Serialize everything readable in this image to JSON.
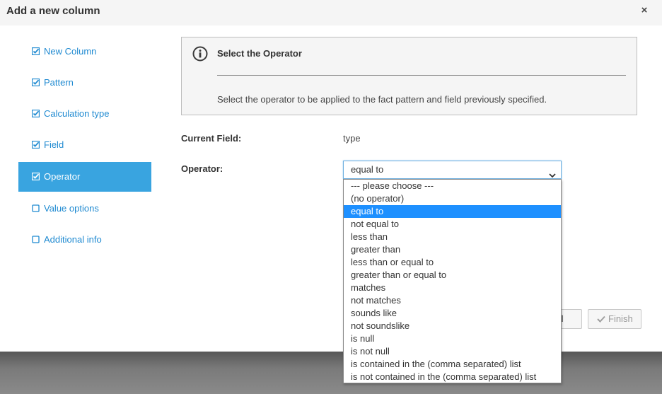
{
  "dialog": {
    "title": "Add a new column",
    "close_glyph": "×"
  },
  "wizard_steps": [
    {
      "label": "New Column",
      "checked": true,
      "active": false
    },
    {
      "label": "Pattern",
      "checked": true,
      "active": false
    },
    {
      "label": "Calculation type",
      "checked": true,
      "active": false
    },
    {
      "label": "Field",
      "checked": true,
      "active": false
    },
    {
      "label": "Operator",
      "checked": true,
      "active": true
    },
    {
      "label": "Value options",
      "checked": false,
      "active": false
    },
    {
      "label": "Additional info",
      "checked": false,
      "active": false
    }
  ],
  "info": {
    "icon": "info-icon",
    "title": "Select the Operator",
    "description": "Select the operator to be applied to the fact pattern and field previously specified."
  },
  "form": {
    "current_field_label": "Current Field:",
    "current_field_value": "type",
    "operator_label": "Operator:",
    "operator_value": "equal to"
  },
  "operator_options": [
    "--- please choose ---",
    "(no operator)",
    "equal to",
    "not equal to",
    "less than",
    "greater than",
    "less than or equal to",
    "greater than or equal to",
    "matches",
    "not matches",
    "sounds like",
    "not soundslike",
    "is null",
    "is not null",
    "is contained in the (comma separated) list",
    "is not contained in the (comma separated) list"
  ],
  "selected_option_index": 2,
  "footer": {
    "cancel_label": "Cancel",
    "finish_label": "Finish"
  },
  "colors": {
    "accent": "#39a4e0",
    "link": "#1f8ad1",
    "selection": "#1e90ff"
  }
}
